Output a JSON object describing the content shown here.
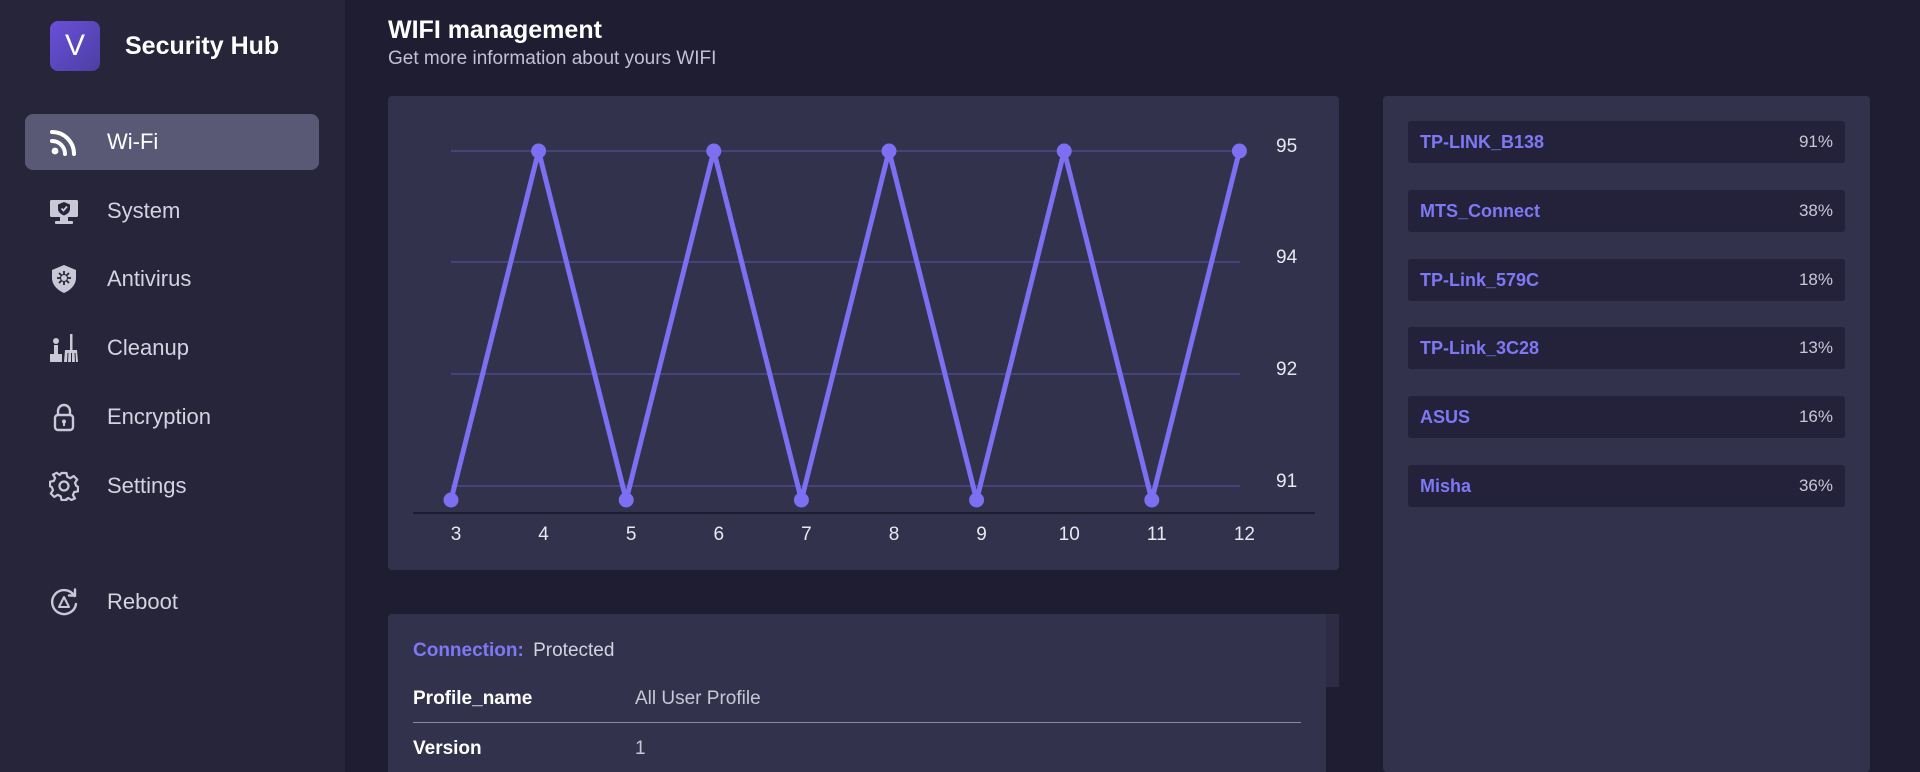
{
  "brand": {
    "logo_letter": "V",
    "name": "Security Hub"
  },
  "sidebar": {
    "items": [
      {
        "label": "Wi-Fi",
        "icon": "wifi-icon",
        "active": true
      },
      {
        "label": "System",
        "icon": "monitor-shield-icon",
        "active": false
      },
      {
        "label": "Antivirus",
        "icon": "shield-virus-icon",
        "active": false
      },
      {
        "label": "Cleanup",
        "icon": "broom-icon",
        "active": false
      },
      {
        "label": "Encryption",
        "icon": "lock-icon",
        "active": false
      },
      {
        "label": "Settings",
        "icon": "gear-icon",
        "active": false
      }
    ],
    "reboot": {
      "label": "Reboot",
      "icon": "reboot-icon"
    }
  },
  "header": {
    "title": "WIFI management",
    "subtitle": "Get more information about yours WIFI"
  },
  "chart_data": {
    "type": "line",
    "x": [
      3,
      4,
      5,
      6,
      7,
      8,
      9,
      10,
      11,
      12
    ],
    "series": [
      {
        "values": [
          91,
          95,
          91,
          95,
          91,
          95,
          91,
          95,
          91,
          95
        ]
      }
    ],
    "y_tick_labels": [
      "95",
      "94",
      "92",
      "91"
    ],
    "x_tick_labels": [
      "3",
      "4",
      "5",
      "6",
      "7",
      "8",
      "9",
      "10",
      "11",
      "12"
    ],
    "color": "#7c6ff2",
    "grid": true,
    "y_axis_position": "right"
  },
  "networks": [
    {
      "name": "TP-LINK_B138",
      "signal": "91%"
    },
    {
      "name": "MTS_Connect",
      "signal": "38%"
    },
    {
      "name": "TP-Link_579C",
      "signal": "18%"
    },
    {
      "name": "TP-Link_3C28",
      "signal": "13%"
    },
    {
      "name": "ASUS",
      "signal": "16%"
    },
    {
      "name": "Misha",
      "signal": "36%"
    }
  ],
  "connection": {
    "label": "Connection:",
    "status": "Protected",
    "properties": [
      {
        "key": "Profile_name",
        "value": "All User Profile"
      },
      {
        "key": "Version",
        "value": "1"
      }
    ]
  },
  "colors": {
    "accent": "#7c6ff2",
    "background": "#1e1d32",
    "sidebar": "#26253a",
    "card": "#33324c",
    "active_item": "#595875"
  }
}
